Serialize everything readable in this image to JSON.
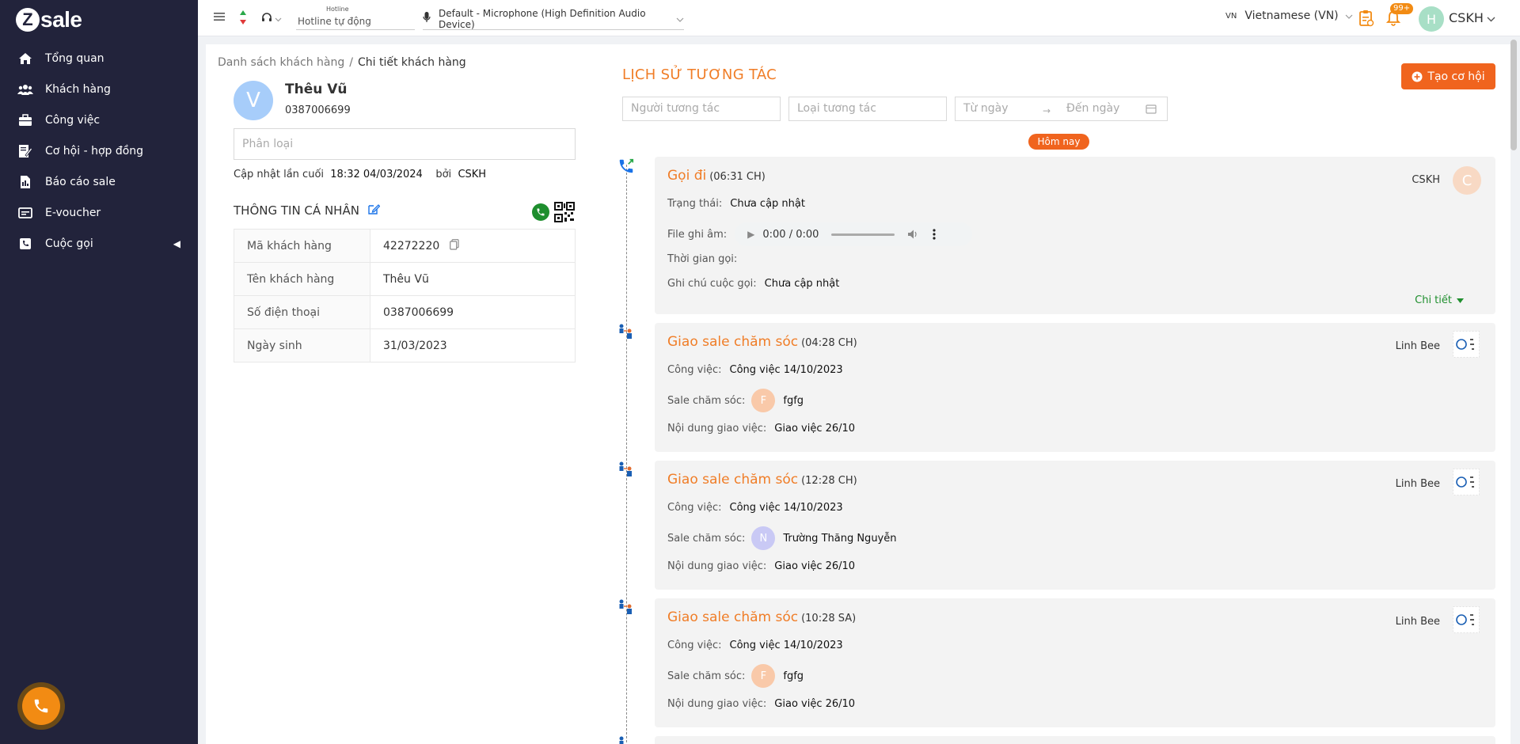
{
  "app": {
    "logo_letter": "Z",
    "logo_text": "sale"
  },
  "sidebar": {
    "items": [
      {
        "label": "Tổng quan",
        "icon": "home-icon"
      },
      {
        "label": "Khách hàng",
        "icon": "users-icon"
      },
      {
        "label": "Công việc",
        "icon": "briefcase-icon"
      },
      {
        "label": "Cơ hội - hợp đồng",
        "icon": "contract-icon"
      },
      {
        "label": "Báo cáo sale",
        "icon": "report-icon"
      },
      {
        "label": "E-voucher",
        "icon": "voucher-icon"
      },
      {
        "label": "Cuộc gọi",
        "icon": "call-log-icon"
      }
    ]
  },
  "topbar": {
    "hotline_label": "Hotline",
    "hotline_value": "Hotline tự động",
    "microphone": "Default - Microphone (High Definition Audio Device)",
    "lang_code": "VN",
    "language": "Vietnamese (VN)",
    "notif_count": "99+",
    "avatar_letter": "H",
    "user": "CSKH"
  },
  "breadcrumb": {
    "parent": "Danh sách khách hàng",
    "separator": "/",
    "current": "Chi tiết khách hàng"
  },
  "customer": {
    "avatar_letter": "V",
    "name": "Thêu Vũ",
    "phone": "0387006699",
    "classify_placeholder": "Phân loại",
    "updated_label": "Cập nhật lần cuối",
    "updated_time": "18:32 04/03/2024",
    "updated_by_label": "bởi",
    "updated_by": "CSKH"
  },
  "personal": {
    "title": "THÔNG TIN CÁ NHÂN",
    "rows": [
      {
        "key": "Mã khách hàng",
        "value": "42272220"
      },
      {
        "key": "Tên khách hàng",
        "value": "Thêu Vũ"
      },
      {
        "key": "Số điện thoại",
        "value": "0387006699"
      },
      {
        "key": "Ngày sinh",
        "value": "31/03/2023"
      }
    ]
  },
  "history": {
    "title": "LỊCH SỬ TƯƠNG TÁC",
    "create_button": "Tạo cơ hội",
    "filters": {
      "interactor": "Người tương tác",
      "type": "Loại tương tác",
      "from": "Từ ngày",
      "arrow": "→",
      "to": "Đến ngày"
    },
    "today": "Hôm nay",
    "call": {
      "title": "Gọi đi",
      "time": "(06:31 CH)",
      "owner": "CSKH",
      "owner_letter": "C",
      "status_label": "Trạng thái:",
      "status_value": "Chưa cập nhật",
      "file_label": "File ghi âm:",
      "audio_time": "0:00 / 0:00",
      "duration_label": "Thời gian gọi:",
      "note_label": "Ghi chú cuộc gọi:",
      "note_value": "Chưa cập nhật",
      "detail": "Chi tiết"
    },
    "assignments": [
      {
        "title": "Giao sale chăm sóc",
        "time": "(04:28 CH)",
        "owner": "Linh Bee",
        "task_label": "Công việc:",
        "task": "Công việc 14/10/2023",
        "sale_label": "Sale chăm sóc:",
        "sale_letter": "F",
        "sale_color": "#f9c9a9",
        "sale": "fgfg",
        "content_label": "Nội dung giao việc:",
        "content": "Giao việc 26/10"
      },
      {
        "title": "Giao sale chăm sóc",
        "time": "(12:28 CH)",
        "owner": "Linh Bee",
        "task_label": "Công việc:",
        "task": "Công việc 14/10/2023",
        "sale_label": "Sale chăm sóc:",
        "sale_letter": "N",
        "sale_color": "#c9c9f5",
        "sale": "Trường Thăng Nguyễn",
        "content_label": "Nội dung giao việc:",
        "content": "Giao việc 26/10"
      },
      {
        "title": "Giao sale chăm sóc",
        "time": "(10:28 SA)",
        "owner": "Linh Bee",
        "task_label": "Công việc:",
        "task": "Công việc 14/10/2023",
        "sale_label": "Sale chăm sóc:",
        "sale_letter": "F",
        "sale_color": "#f9c9a9",
        "sale": "fgfg",
        "content_label": "Nội dung giao việc:",
        "content": "Giao việc 26/10"
      }
    ]
  }
}
